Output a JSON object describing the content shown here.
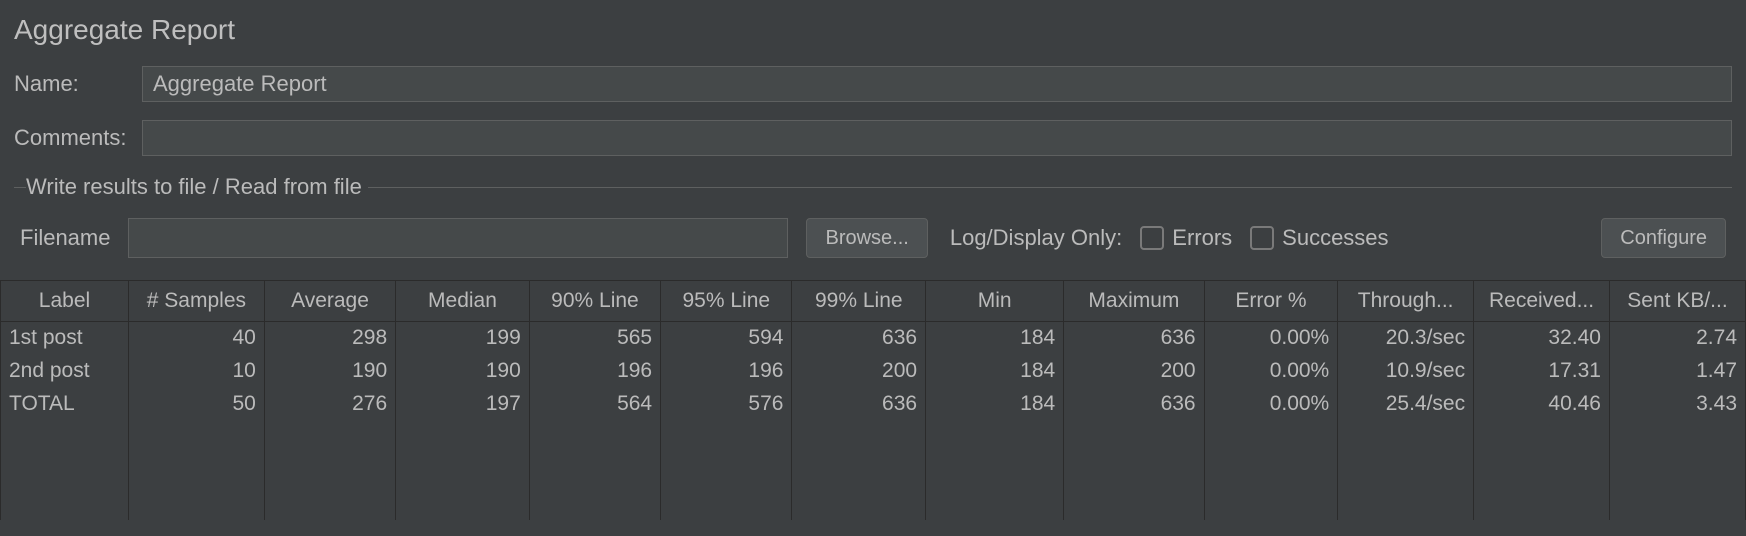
{
  "title": "Aggregate Report",
  "form": {
    "name_label": "Name:",
    "name_value": "Aggregate Report",
    "comments_label": "Comments:",
    "comments_value": ""
  },
  "file_group": {
    "legend": "Write results to file / Read from file",
    "filename_label": "Filename",
    "filename_value": "",
    "browse_label": "Browse...",
    "logdisplay_label": "Log/Display Only:",
    "errors_label": "Errors",
    "successes_label": "Successes",
    "configure_label": "Configure"
  },
  "table": {
    "headers": [
      "Label",
      "# Samples",
      "Average",
      "Median",
      "90% Line",
      "95% Line",
      "99% Line",
      "Min",
      "Maximum",
      "Error %",
      "Through...",
      "Received...",
      "Sent KB/..."
    ],
    "rows": [
      {
        "label": "1st post",
        "samples": "40",
        "average": "298",
        "median": "199",
        "p90": "565",
        "p95": "594",
        "p99": "636",
        "min": "184",
        "max": "636",
        "error": "0.00%",
        "throughput": "20.3/sec",
        "received": "32.40",
        "sent": "2.74"
      },
      {
        "label": "2nd post",
        "samples": "10",
        "average": "190",
        "median": "190",
        "p90": "196",
        "p95": "196",
        "p99": "200",
        "min": "184",
        "max": "200",
        "error": "0.00%",
        "throughput": "10.9/sec",
        "received": "17.31",
        "sent": "1.47"
      },
      {
        "label": "TOTAL",
        "samples": "50",
        "average": "276",
        "median": "197",
        "p90": "564",
        "p95": "576",
        "p99": "636",
        "min": "184",
        "max": "636",
        "error": "0.00%",
        "throughput": "25.4/sec",
        "received": "40.46",
        "sent": "3.43"
      }
    ]
  }
}
